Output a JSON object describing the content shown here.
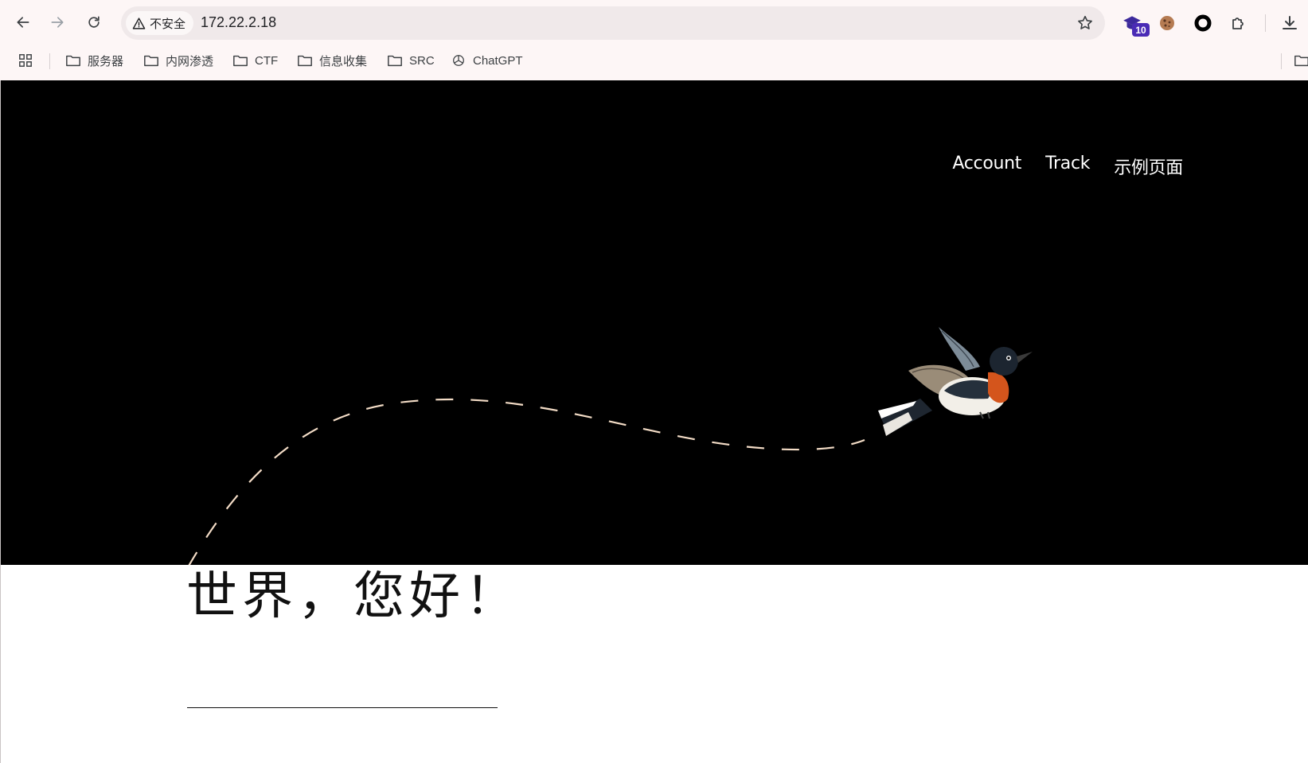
{
  "browser": {
    "security_label": "不安全",
    "url": "172.22.2.18",
    "extension_badge": "10",
    "bookmarks": [
      {
        "label": "服务器",
        "icon": "folder-icon"
      },
      {
        "label": "内网渗透",
        "icon": "folder-icon"
      },
      {
        "label": "CTF",
        "icon": "folder-icon"
      },
      {
        "label": "信息收集",
        "icon": "folder-icon"
      },
      {
        "label": "SRC",
        "icon": "folder-icon"
      },
      {
        "label": "ChatGPT",
        "icon": "openai-icon"
      }
    ]
  },
  "site": {
    "nav": [
      "Account",
      "Track",
      "示例页面"
    ],
    "headline": "世界，您好！",
    "colors": {
      "hero_bg": "#000000",
      "path_dash": "#f3dcc6",
      "nav_text": "#ffffff"
    }
  }
}
